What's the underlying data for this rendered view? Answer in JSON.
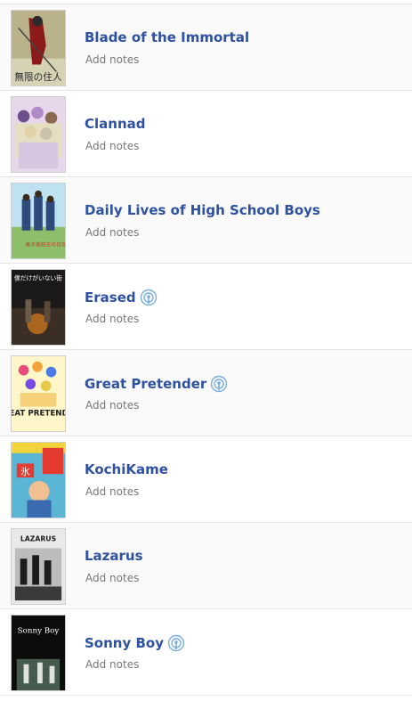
{
  "list": {
    "items": [
      {
        "title": "Blade of the Immortal",
        "notes_label": "Add notes",
        "has_broadcast_icon": false,
        "cover_text": "無限の住人",
        "cover_colors": [
          "#b9b28a",
          "#8c1a1a",
          "#2b2b2b"
        ]
      },
      {
        "title": "Clannad",
        "notes_label": "Add notes",
        "has_broadcast_icon": false,
        "cover_text": "",
        "cover_colors": [
          "#e8d7ea",
          "#b08ac8",
          "#e6e0b8"
        ]
      },
      {
        "title": "Daily Lives of High School Boys",
        "notes_label": "Add notes",
        "has_broadcast_icon": false,
        "cover_text": "男子高校生の日常",
        "cover_colors": [
          "#bfe2f0",
          "#2e4a7a",
          "#8dbf6a"
        ]
      },
      {
        "title": "Erased",
        "notes_label": "Add notes",
        "has_broadcast_icon": true,
        "cover_text": "僕だけがいない街",
        "cover_colors": [
          "#1c1a18",
          "#c8731e",
          "#3a2e25"
        ]
      },
      {
        "title": "Great Pretender",
        "notes_label": "Add notes",
        "has_broadcast_icon": true,
        "cover_text": "GREAT PRETENDER",
        "cover_colors": [
          "#fff6c9",
          "#e84a7a",
          "#1f1f1f"
        ]
      },
      {
        "title": "KochiKame",
        "notes_label": "Add notes",
        "has_broadcast_icon": false,
        "cover_text": "氷",
        "cover_colors": [
          "#5bb6d6",
          "#e43a2f",
          "#f2d33a"
        ]
      },
      {
        "title": "Lazarus",
        "notes_label": "Add notes",
        "has_broadcast_icon": false,
        "cover_text": "LAZARUS",
        "cover_colors": [
          "#e9e9e9",
          "#1b1b1b",
          "#6b6b6b"
        ]
      },
      {
        "title": "Sonny Boy",
        "notes_label": "Add notes",
        "has_broadcast_icon": true,
        "cover_text": "Sonny Boy",
        "cover_colors": [
          "#0c0c0c",
          "#ffffff",
          "#5d7d6b"
        ]
      }
    ]
  },
  "icons": {
    "broadcast": "broadcast-icon"
  },
  "colors": {
    "title_link": "#2e51a2",
    "notes_text": "#787878",
    "broadcast_icon": "#7aaee0"
  }
}
